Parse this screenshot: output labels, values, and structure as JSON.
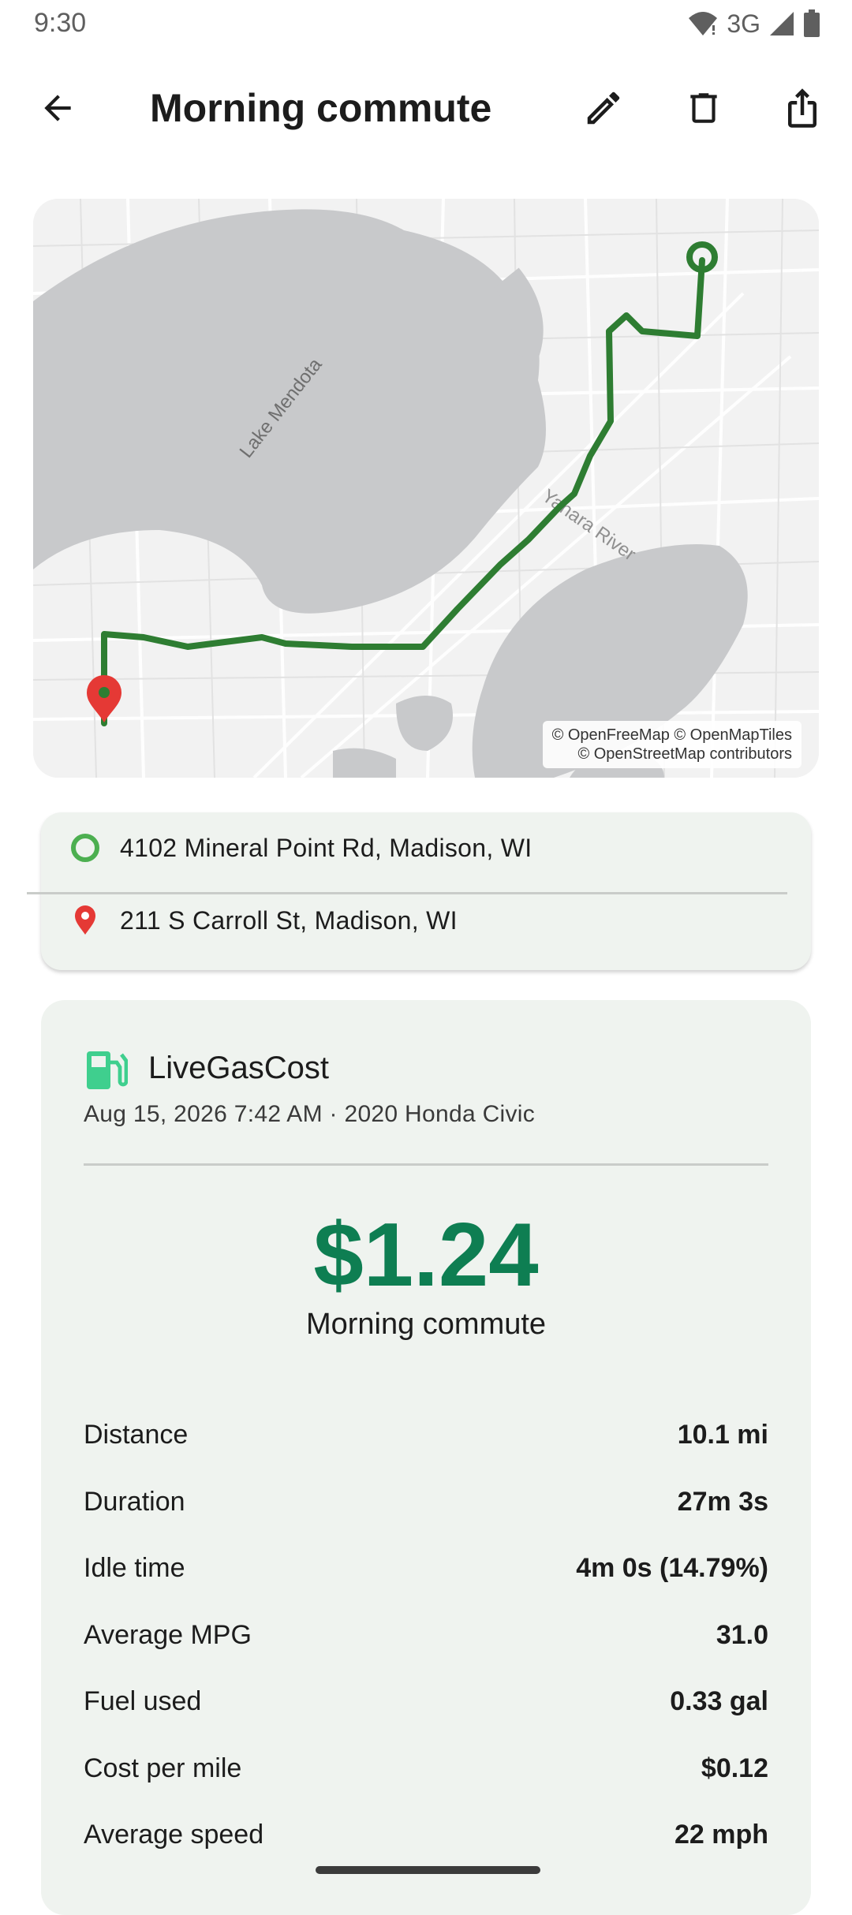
{
  "status_bar": {
    "time": "9:30",
    "network": "3G",
    "icons": [
      "wifi-icon",
      "signal-icon",
      "battery-icon"
    ]
  },
  "app_bar": {
    "title": "Morning commute",
    "actions": [
      "back-arrow-icon",
      "edit-pencil-icon",
      "delete-trash-icon",
      "share-icon"
    ]
  },
  "map": {
    "labels": {
      "lake_mendota": "Lake Mendota",
      "yahara_river": "Yahara River"
    },
    "attribution_line1": "© OpenFreeMap © OpenMapTiles",
    "attribution_line2": "© OpenStreetMap contributors",
    "route_color": "#2e7d32",
    "end_pin_color": "#e53935"
  },
  "addresses": {
    "start": "4102 Mineral Point Rd, Madison, WI",
    "end": "211 S Carroll St, Madison, WI"
  },
  "summary": {
    "brand": "LiveGasCost",
    "meta": "Aug 15, 2026 7:42 AM · 2020 Honda Civic",
    "total_cost": "$1.24",
    "trip_name": "Morning commute",
    "accent_color": "#0e7e52",
    "stats": [
      {
        "label": "Distance",
        "value": "10.1 mi"
      },
      {
        "label": "Duration",
        "value": "27m 3s"
      },
      {
        "label": "Idle time",
        "value": "4m 0s (14.79%)"
      },
      {
        "label": "Average MPG",
        "value": "31.0"
      },
      {
        "label": "Fuel used",
        "value": "0.33 gal"
      },
      {
        "label": "Cost per mile",
        "value": "$0.12"
      },
      {
        "label": "Average speed",
        "value": "22 mph"
      }
    ]
  }
}
